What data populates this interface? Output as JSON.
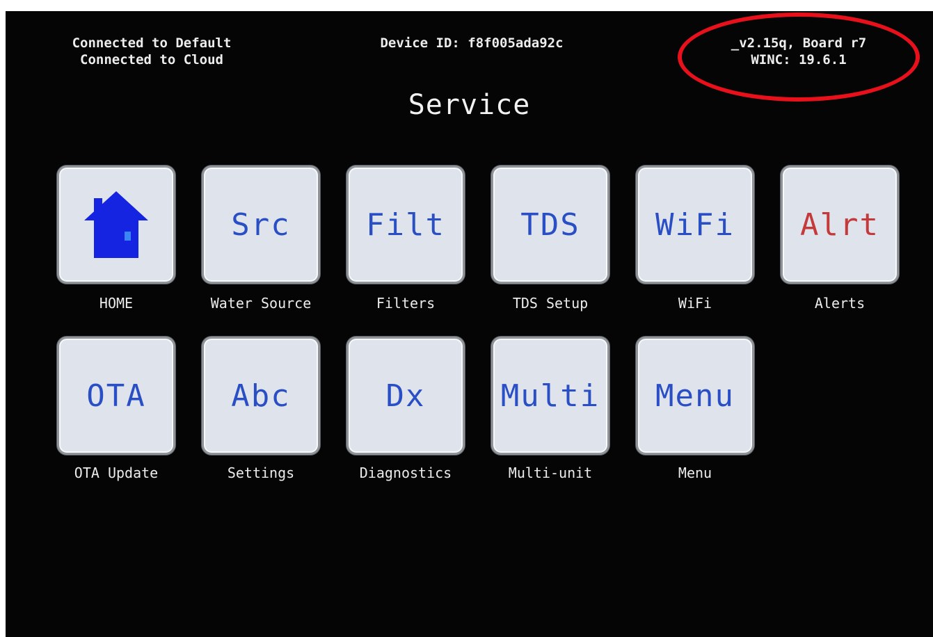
{
  "status": {
    "connection_lines": [
      "Connected to Default",
      "Connected to Cloud"
    ],
    "device_id": "Device ID: f8f005ada92c",
    "version_lines": [
      "_v2.15q, Board r7",
      "WINC: 19.6.1"
    ]
  },
  "page": {
    "title": "Service"
  },
  "tiles_row1": [
    {
      "tile_text": "",
      "icon": "home-icon",
      "label": "HOME"
    },
    {
      "tile_text": "Src",
      "label": "Water Source"
    },
    {
      "tile_text": "Filt",
      "label": "Filters"
    },
    {
      "tile_text": "TDS",
      "label": "TDS Setup"
    },
    {
      "tile_text": "WiFi",
      "label": "WiFi"
    },
    {
      "tile_text": "Alrt",
      "label": "Alerts"
    }
  ],
  "tiles_row2": [
    {
      "tile_text": "OTA",
      "label": "OTA Update"
    },
    {
      "tile_text": "Abc",
      "label": "Settings"
    },
    {
      "tile_text": "Dx",
      "label": "Diagnostics"
    },
    {
      "tile_text": "Multi",
      "label": "Multi-unit"
    },
    {
      "tile_text": "Menu",
      "label": "Menu"
    }
  ],
  "colors": {
    "screen_bg": "#050505",
    "tile_bg": "#dfe4ec",
    "tile_text": "#2a4fc4",
    "alert_text": "#c43a3a",
    "home_icon": "#1424e0",
    "annotation": "#e8101a"
  }
}
